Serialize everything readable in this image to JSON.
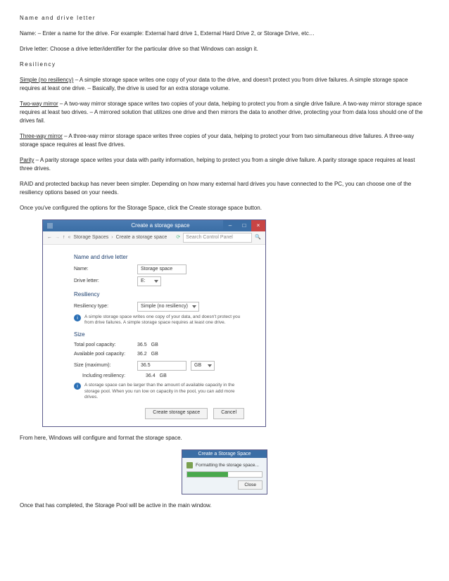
{
  "section1_title": "Name and drive letter",
  "p_name": "Name: – Enter a name for the drive. For example: External hard drive 1, External Hard Drive 2, or Storage Drive, etc…",
  "p_driveletter": "Drive letter: Choose a drive letter/identifier for the particular drive so that Windows can assign it.",
  "section2_title": "Resiliency",
  "simple_term": "Simple (no resiliency)",
  "simple_text": " – A simple storage space writes one copy of your data to the drive, and doesn't protect you from drive failures. A simple storage space requires at least one drive. – Basically, the drive is used for an extra storage volume.",
  "twoway_term": "Two-way mirror",
  "twoway_text": " – A two-way mirror storage space writes two copies of your data, helping to protect you from a single drive failure. A two-way mirror storage space requires at least two drives. – A mirrored solution that utilizes one drive and then mirrors the data to another drive, protecting your from data loss should one of the drives fail.",
  "threeway_term": "Three-way mirror",
  "threeway_text": " – A three-way mirror storage space writes three copies of your data, helping to protect your from two simultaneous drive failures. A three-way storage space requires at least five drives.",
  "parity_term": "Parity",
  "parity_text": " – A parity storage space writes your data with parity information, helping to protect you from a single drive failure. A parity storage space requires at least three drives.",
  "p_raid": "RAID and protected backup has never been simpler. Depending on how many external hard drives you have connected to the PC, you can choose one of the resiliency options based on your needs.",
  "p_click": "Once you've configured the options for the Storage Space, click the Create storage space button.",
  "p_fromhere": "From here, Windows will configure and format the storage space.",
  "p_once": "Once that has completed, the Storage Pool will be active in the main window.",
  "dlg": {
    "title": "Create a storage space",
    "min": "–",
    "max": "□",
    "close": "×",
    "crumb_a": "Storage Spaces",
    "crumb_b": "Create a storage space",
    "search_ph": "Search Control Panel",
    "grp_name": "Name and drive letter",
    "lbl_name": "Name:",
    "val_name": "Storage space",
    "lbl_drive": "Drive letter:",
    "val_drive": "E:",
    "grp_res": "Resiliency",
    "lbl_restype": "Resiliency type:",
    "val_restype": "Simple (no resiliency)",
    "info_res": "A simple storage space writes one copy of your data, and doesn't protect you from drive failures. A simple storage space requires at least one drive.",
    "grp_size": "Size",
    "lbl_total": "Total pool capacity:",
    "val_total": "36.5",
    "unit": "GB",
    "lbl_avail": "Available pool capacity:",
    "val_avail": "36.2",
    "lbl_max": "Size (maximum):",
    "val_max": "36.5",
    "lbl_incl": "Including resiliency:",
    "val_incl": "36.4",
    "info_size": "A storage space can be larger than the amount of available capacity in the storage pool. When you run low on capacity in the pool, you can add more drives.",
    "btn_create": "Create storage space",
    "btn_cancel": "Cancel"
  },
  "prog": {
    "title": "Create a Storage Space",
    "msg": "Formatting the storage space...",
    "close": "Close"
  }
}
